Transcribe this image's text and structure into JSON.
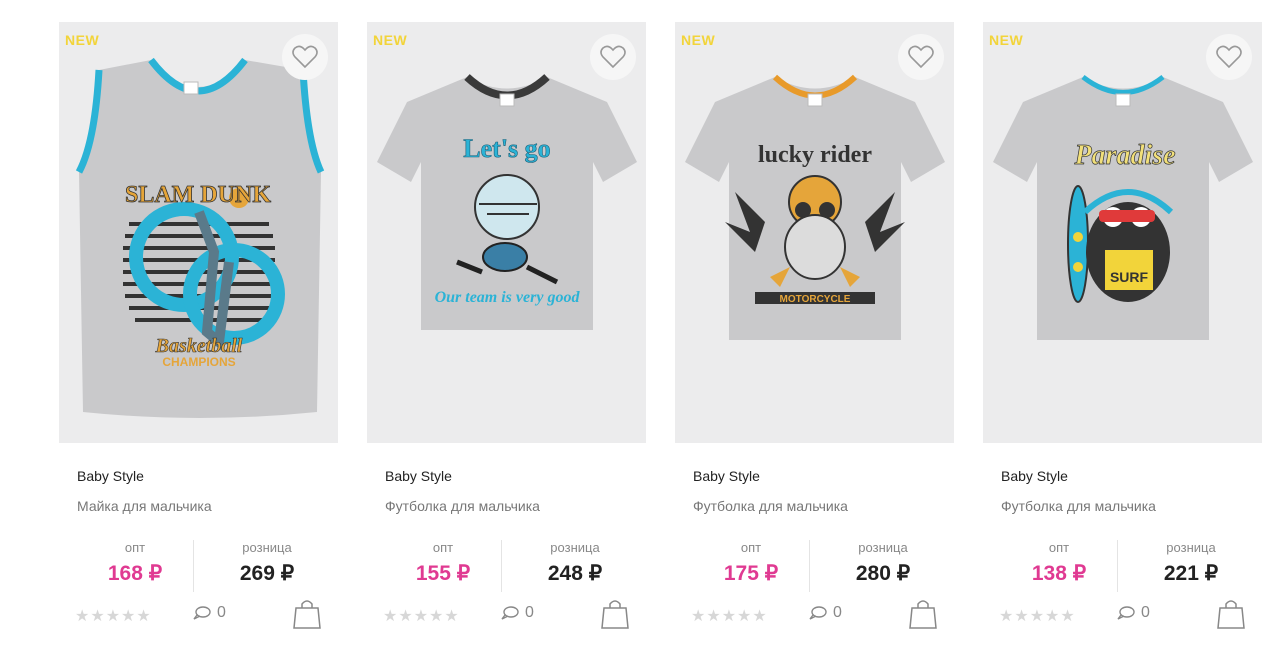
{
  "products": [
    {
      "badge": "NEW",
      "brand": "Baby Style",
      "title": "Майка для мальчика",
      "opt_label": "опт",
      "opt_price": "168 ₽",
      "retail_label": "розница",
      "retail_price": "269 ₽",
      "rating_stars": "★★★★★",
      "comments": "0",
      "print_text_1": "SLAM DUNK",
      "print_text_2": "83",
      "print_text_3": "Basketball CHAMPIONS"
    },
    {
      "badge": "NEW",
      "brand": "Baby Style",
      "title": "Футболка для мальчика",
      "opt_label": "опт",
      "opt_price": "155 ₽",
      "retail_label": "розница",
      "retail_price": "248 ₽",
      "rating_stars": "★★★★★",
      "comments": "0",
      "print_text_1": "Let's go",
      "print_text_2": "",
      "print_text_3": "Our team is very good"
    },
    {
      "badge": "NEW",
      "brand": "Baby Style",
      "title": "Футболка для мальчика",
      "opt_label": "опт",
      "opt_price": "175 ₽",
      "retail_label": "розница",
      "retail_price": "280 ₽",
      "rating_stars": "★★★★★",
      "comments": "0",
      "print_text_1": "lucky rider",
      "print_text_2": "",
      "print_text_3": "MOTORCYCLE"
    },
    {
      "badge": "NEW",
      "brand": "Baby Style",
      "title": "Футболка для мальчика",
      "opt_label": "опт",
      "opt_price": "138 ₽",
      "retail_label": "розница",
      "retail_price": "221 ₽",
      "rating_stars": "★★★★★",
      "comments": "0",
      "print_text_1": "Paradise",
      "print_text_2": "",
      "print_text_3": "SURF"
    }
  ],
  "colors": {
    "badge": "#f2d43a",
    "opt_price": "#e03a92",
    "retail_price": "#222222",
    "card_bg": "#ececed"
  }
}
